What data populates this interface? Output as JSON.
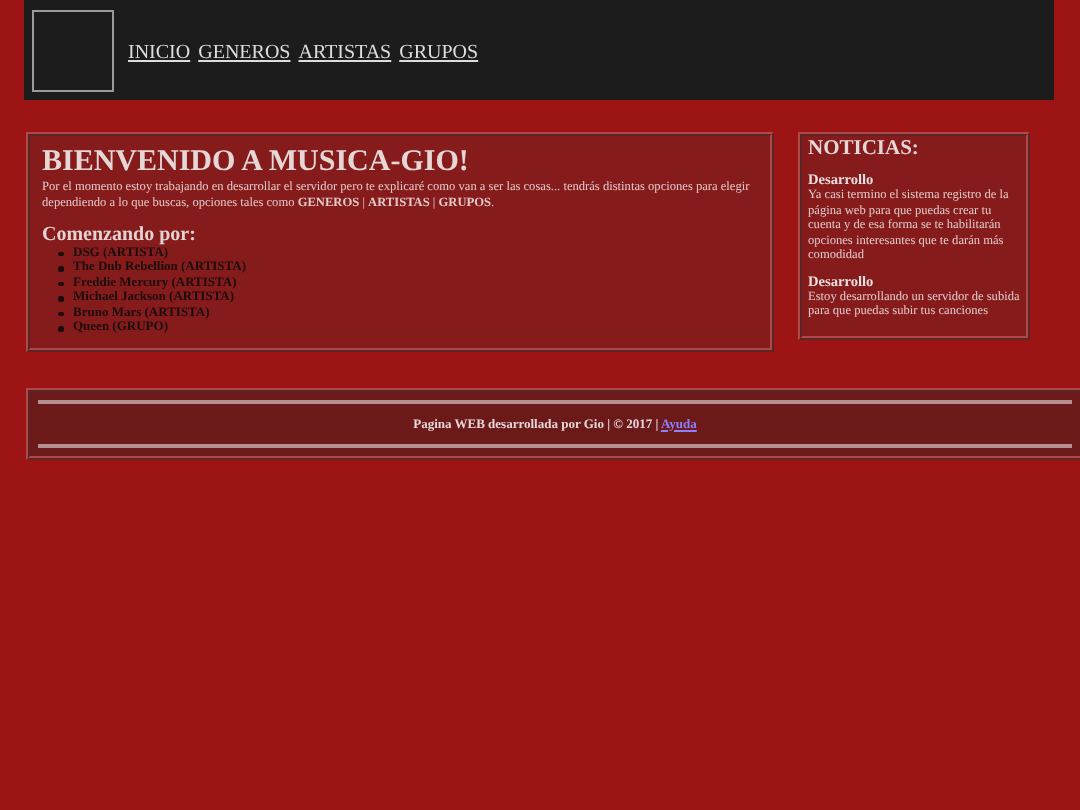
{
  "header": {
    "nav": [
      "INICIO",
      "GENEROS",
      "ARTISTAS",
      "GRUPOS"
    ]
  },
  "main": {
    "title": "BIENVENIDO A MUSICA-GIO!",
    "intro": "Por el momento estoy trabajando en desarrollar el servidor pero te explicaré como van a ser las cosas... tendrás distintas opciones para elegir dependiendo a lo que buscas, opciones tales como **GENEROS** | **ARTISTAS** | **GRUPOS**.",
    "subtitle": "Comenzando por:",
    "items": [
      "DSG (ARTISTA)",
      "The Dub Rebellion (ARTISTA)",
      "Freddie Mercury (ARTISTA)",
      "Michael Jackson (ARTISTA)",
      "Bruno Mars (ARTISTA)",
      "Queen (GRUPO)"
    ]
  },
  "news": {
    "title": "NOTICIAS:",
    "entries": [
      {
        "title": "Desarrollo",
        "text": "Ya casi termino el sistema registro de la página web para que puedas crear tu cuenta y de esa forma se te habilitarán opciones interesantes que te darán más comodidad"
      },
      {
        "title": "Desarrollo",
        "text": "Estoy desarrollando un servidor de subida para que puedas subir tus canciones"
      }
    ]
  },
  "footer": {
    "text": "Pagina WEB desarrollada por Gio | © 2017 |",
    "link": "Ayuda"
  }
}
